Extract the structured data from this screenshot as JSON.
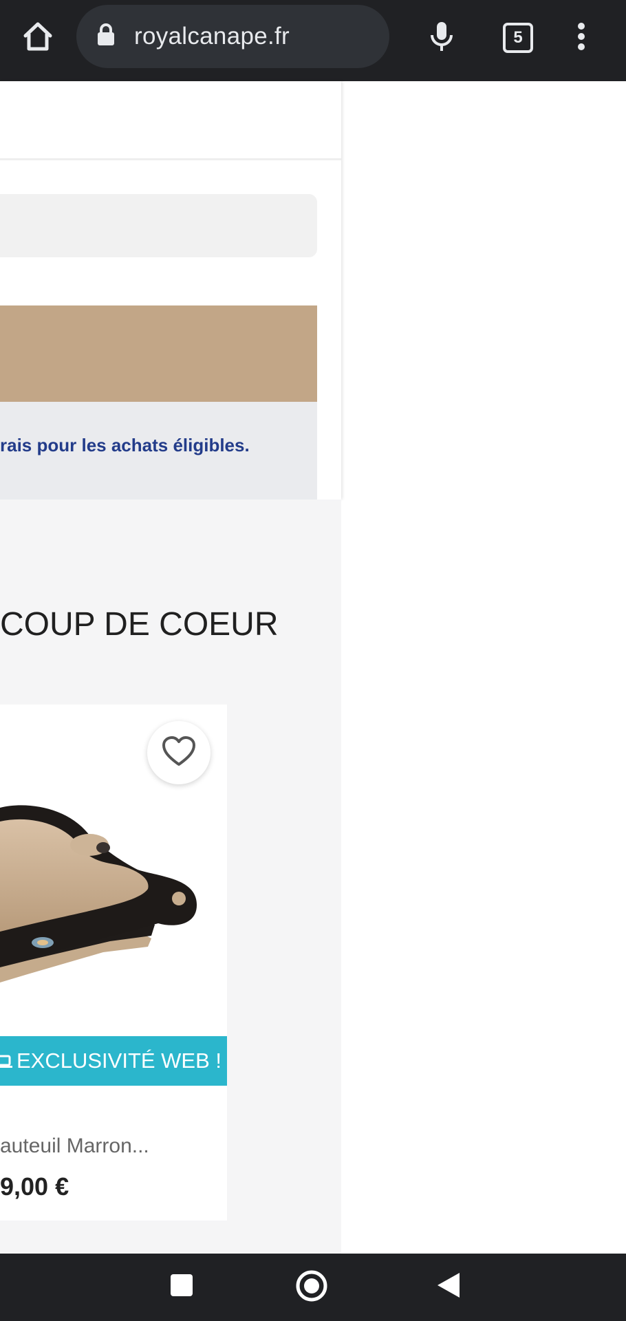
{
  "browser": {
    "url": "royalcanape.fr",
    "tab_count": "5",
    "icons": {
      "home": "home-icon",
      "lock": "lock-icon",
      "mic": "microphone-icon",
      "tabs": "tab-switcher-icon",
      "menu": "more-vert-icon"
    }
  },
  "page": {
    "info_text": "rais pour les achats éligibles.",
    "section_title": "COUP DE COEUR",
    "product": {
      "badge_label": "EXCLUSIVITÉ WEB !",
      "name": "auteuil Marron...",
      "price": "9,00 €"
    }
  },
  "colors": {
    "banner": "#c2a687",
    "info_text": "#233c8a",
    "badge": "#2bb6cc"
  },
  "system_nav": {
    "icons": [
      "recents-icon",
      "home-circle-icon",
      "back-icon"
    ]
  }
}
